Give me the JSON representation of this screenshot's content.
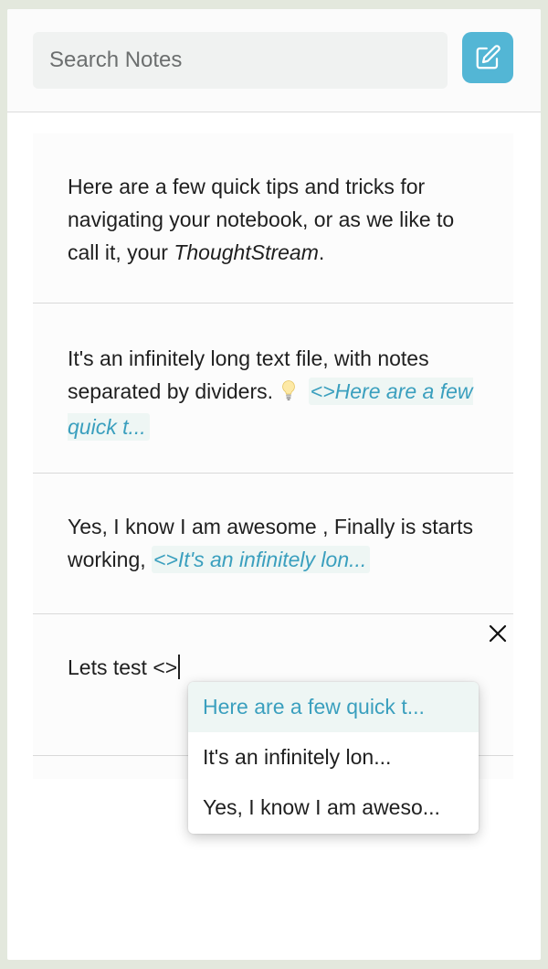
{
  "search": {
    "placeholder": "Search Notes"
  },
  "compose_button": {
    "icon": "edit-note-icon",
    "color": "#53b6d5"
  },
  "notes": [
    {
      "text_before": "Here are a few quick tips and tricks for navigating your notebook, or as we like to call it, your ",
      "emphasis": "ThoughtStream",
      "text_after": "."
    },
    {
      "text": "It's an infinitely long text file, with notes separated by dividers.",
      "emoji": "lightbulb",
      "ref_label": "<>Here are a few quick t..."
    },
    {
      "text": "Yes, I know I am awesome , Finally is starts working,",
      "ref_label": "<>It's an infinitely lon..."
    },
    {
      "text": "Lets test <>"
    }
  ],
  "close_icon": "close-icon",
  "dropdown": {
    "options": [
      "Here are a few quick t...",
      "It's an infinitely lon...",
      "Yes, I know I am aweso..."
    ],
    "active_index": 0,
    "accent": "#3a9fbe"
  }
}
